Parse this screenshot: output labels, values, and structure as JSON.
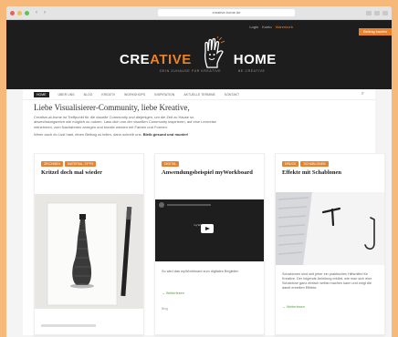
{
  "browser": {
    "url": "creative-home.de"
  },
  "header": {
    "topnav": [
      "Login",
      "Konto",
      "Warenkorb"
    ],
    "cta": "Beitrag kaufen",
    "logo": {
      "part1": "CRE",
      "part2": "ATIVE",
      "part3": "HOME"
    },
    "tagline_left": "DEIN ZUHAUSE FÜR KREATIVE",
    "tagline_right": "BE CREATIVE"
  },
  "nav": {
    "items": [
      "HOME",
      "ÜBER UNS",
      "BLOG",
      "KREATIV",
      "WORKSHOPS",
      "INSPIRATION",
      "AKTUELLE TERMINE",
      "KONTAKT"
    ]
  },
  "intro": {
    "title": "Liebe Visualisierer-Community, liebe Kreative,",
    "para1": "Creative-at-home ist Treffpunkt für die visuelle Community und diejenigen, um die Zeit zu Hause so abwechslungsreich wie möglich zu nutzen. Lass dich von der visuellen Community inspirieren, auf eine Lernreise mitnehmen, zum Nachahmen anregen und kreativ werden mit Farben und Formen.",
    "para2": "Wenn auch du Lust hast, einen Beitrag zu teilen, dann schreib uns. ",
    "para2_bold": "Bleib gesund und munter!"
  },
  "cards": [
    {
      "tags": [
        "ZEICHNEN",
        "MATERIAL-TIPPS"
      ],
      "title": "Kritzel doch mal wieder",
      "colors": {
        "bottle": "#3a3a3a",
        "pen": "#222222"
      }
    },
    {
      "tags": [
        "DIGITAL"
      ],
      "title": "Anwendungsbeispiel myWorkboard",
      "video_label": "myWorkboard",
      "text": "So wird das myWorkboard zum digitalen Begleiter.",
      "more": "→ Weiterlesen",
      "date": "Blog"
    },
    {
      "tags": [
        "DRUCK",
        "SCHABLONEN"
      ],
      "title": "Effekte mit Schablonen",
      "text": "Schablonen sind seit jeher ein praktisches Hilfsmittel für Kreative. Der folgende Anleitung erklärt, wie man sich eine Schablone ganz einfach selbst machen kann und zeigt die damit erzielten Effekte.",
      "more": "→ Weiterlesen"
    }
  ]
}
